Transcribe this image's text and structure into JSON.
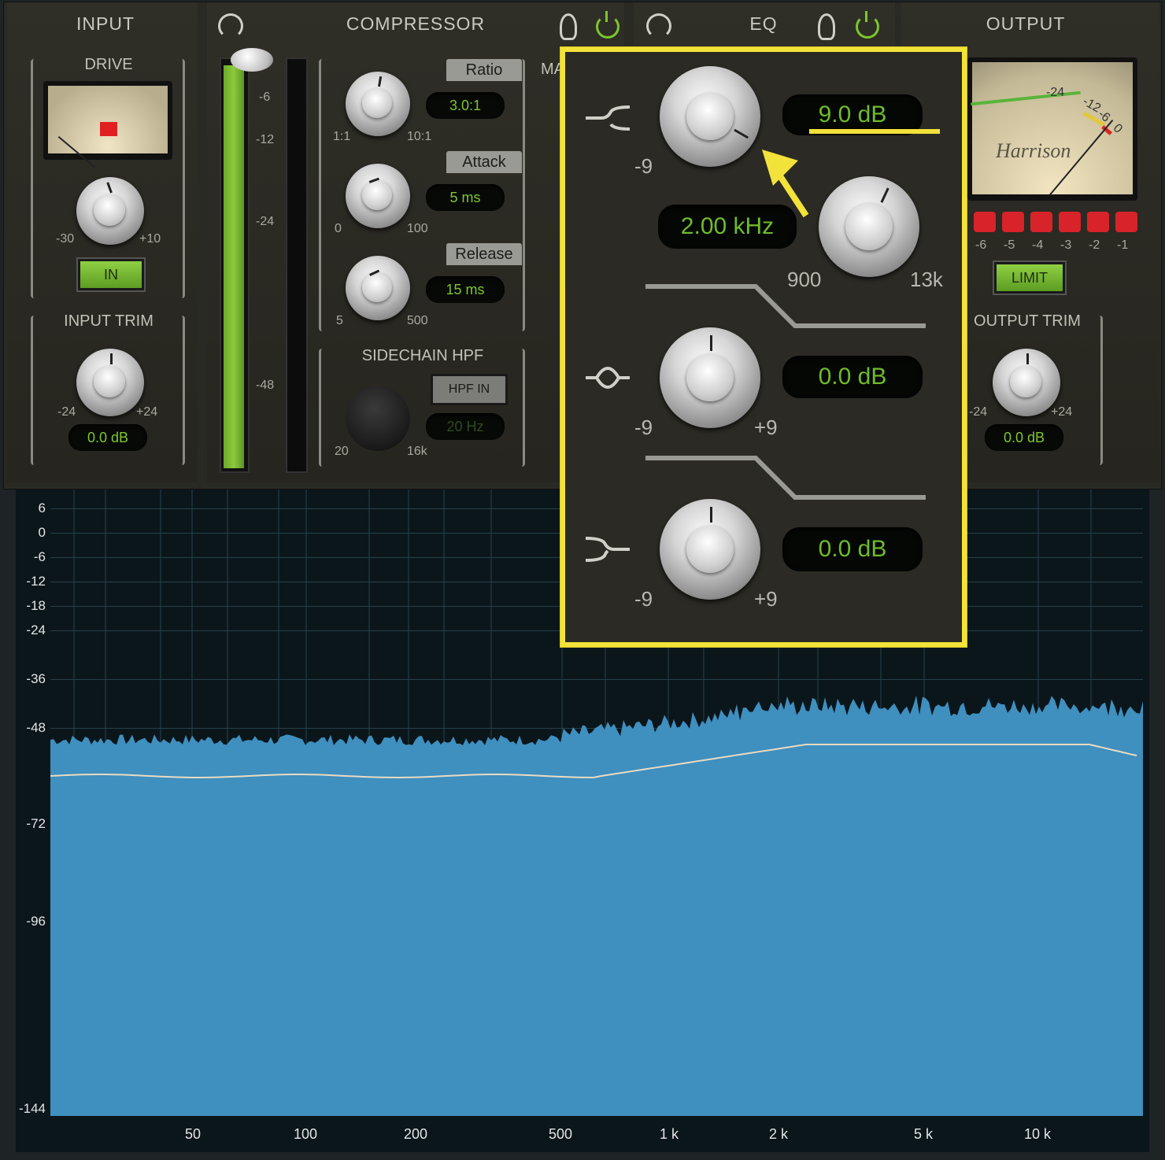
{
  "input": {
    "title": "INPUT",
    "drive_label": "DRIVE",
    "drive_min": "-30",
    "drive_max": "+10",
    "in_button": "IN",
    "trim_label": "INPUT TRIM",
    "trim_min": "-24",
    "trim_max": "+24",
    "trim_readout": "0.0 dB"
  },
  "meter": {
    "scale": [
      "-6",
      "-12",
      "-24",
      "-48"
    ]
  },
  "compressor": {
    "title": "COMPRESSOR",
    "ratio_label": "Ratio",
    "ratio_value": "3.0:1",
    "ratio_min": "1:1",
    "ratio_max": "10:1",
    "attack_label": "Attack",
    "attack_value": "5 ms",
    "attack_min": "0",
    "attack_max": "100",
    "release_label": "Release",
    "release_value": "15 ms",
    "release_min": "5",
    "release_max": "500",
    "sidechain_label": "SIDECHAIN HPF",
    "hpf_button": "HPF IN",
    "hpf_value": "20 Hz",
    "hpf_min": "20",
    "hpf_max": "16k",
    "makeup_partial": "MA"
  },
  "eq": {
    "title": "EQ",
    "high_gain_readout": "9.0 dB",
    "high_min": "-9",
    "freq_readout": "2.00 kHz",
    "freq_min": "900",
    "freq_max": "13k",
    "mid_gain_readout": "0.0 dB",
    "mid_min": "-9",
    "mid_max": "+9",
    "low_gain_readout": "0.0 dB",
    "low_min": "-9",
    "low_max": "+9"
  },
  "output": {
    "title": "OUTPUT",
    "vu_brand": "Harrison",
    "vu_scale": [
      "-24",
      "-12",
      "-6",
      "0"
    ],
    "led_labels": [
      "-6",
      "-5",
      "-4",
      "-3",
      "-2",
      "-1"
    ],
    "limit_button": "LIMIT",
    "trim_label": "OUTPUT TRIM",
    "trim_min": "-24",
    "trim_max": "+24",
    "trim_readout": "0.0 dB"
  },
  "analyzer": {
    "y_labels": [
      "6",
      "0",
      "-6",
      "-12",
      "-18",
      "-24",
      "-36",
      "-48",
      "-72",
      "-96",
      "-144"
    ],
    "x_labels": [
      "50",
      "100",
      "200",
      "500",
      "1 k",
      "2 k",
      "5 k",
      "10 k"
    ]
  },
  "colors": {
    "accent_green": "#7cc72a",
    "highlight_yellow": "#f2e23a",
    "spectrum_blue": "#3f8fbf",
    "led_red": "#d8232a"
  }
}
